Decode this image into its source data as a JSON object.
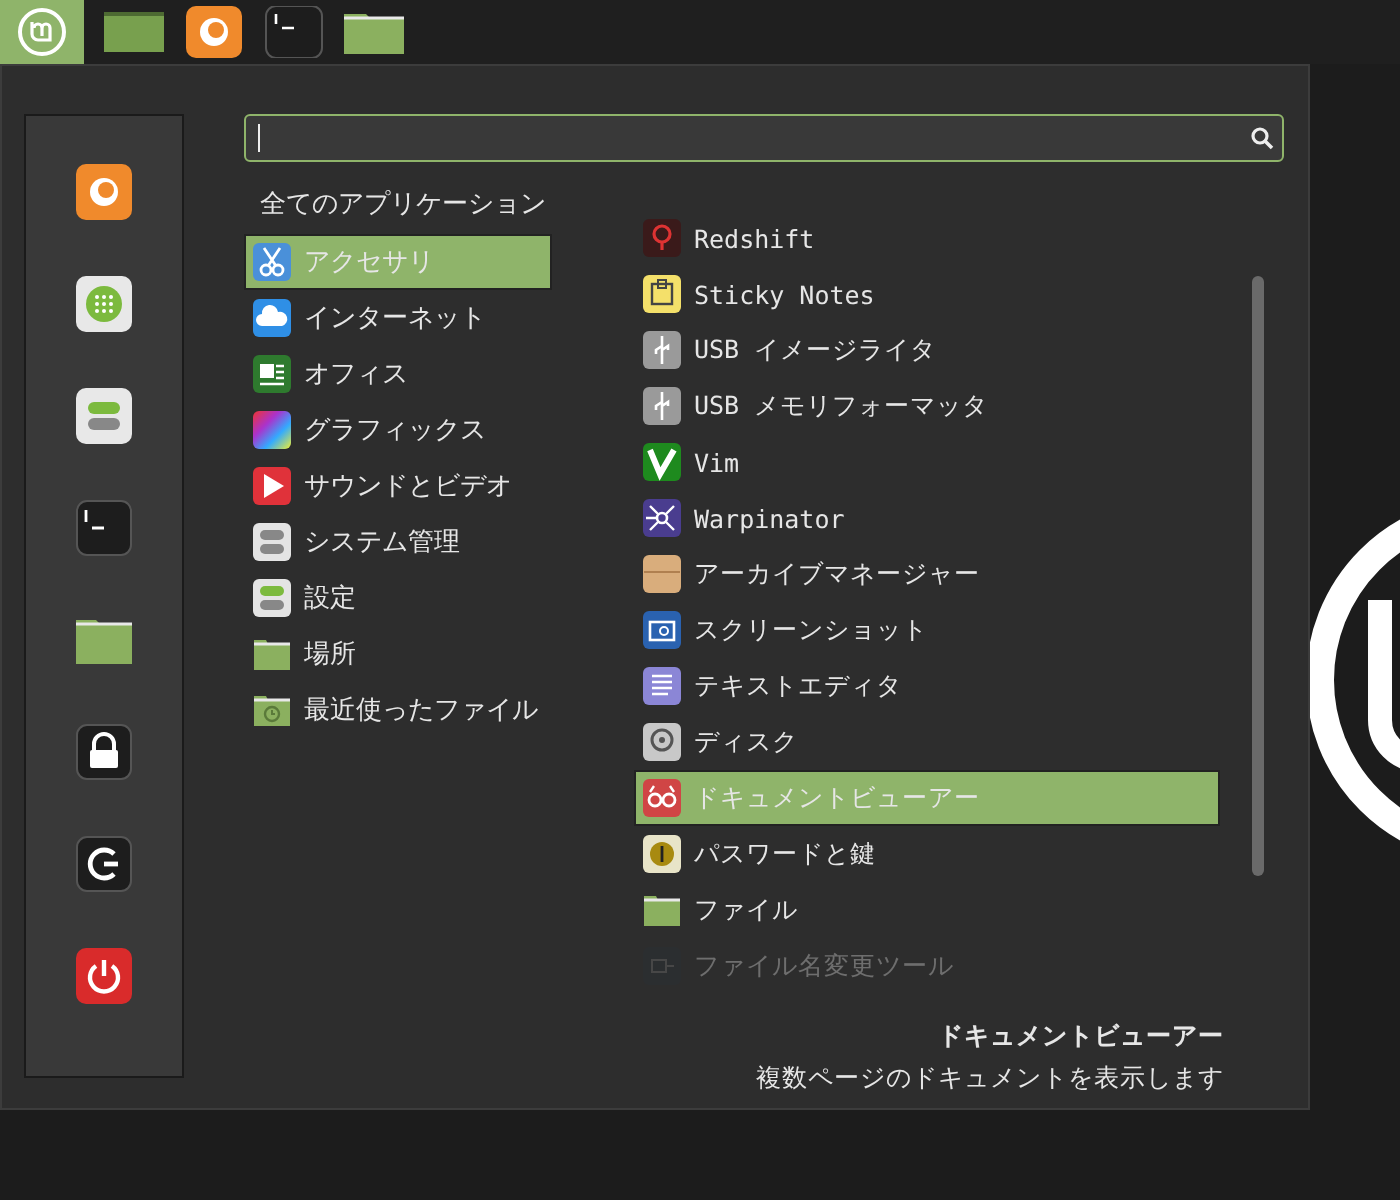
{
  "categories": {
    "header": "全てのアプリケーション",
    "items": [
      {
        "label": "アクセサリ",
        "selected": true
      },
      {
        "label": "インターネット",
        "selected": false
      },
      {
        "label": "オフィス",
        "selected": false
      },
      {
        "label": "グラフィックス",
        "selected": false
      },
      {
        "label": "サウンドとビデオ",
        "selected": false
      },
      {
        "label": "システム管理",
        "selected": false
      },
      {
        "label": "設定",
        "selected": false
      },
      {
        "label": "場所",
        "selected": false
      },
      {
        "label": "最近使ったファイル",
        "selected": false
      }
    ]
  },
  "apps": [
    {
      "name": "Redshift",
      "selected": false,
      "faded": false
    },
    {
      "name": "Sticky Notes",
      "selected": false,
      "faded": false
    },
    {
      "name": "USB イメージライタ",
      "selected": false,
      "faded": false
    },
    {
      "name": "USB メモリフォーマッタ",
      "selected": false,
      "faded": false
    },
    {
      "name": "Vim",
      "selected": false,
      "faded": false
    },
    {
      "name": "Warpinator",
      "selected": false,
      "faded": false
    },
    {
      "name": "アーカイブマネージャー",
      "selected": false,
      "faded": false
    },
    {
      "name": "スクリーンショット",
      "selected": false,
      "faded": false
    },
    {
      "name": "テキストエディタ",
      "selected": false,
      "faded": false
    },
    {
      "name": "ディスク",
      "selected": false,
      "faded": false
    },
    {
      "name": "ドキュメントビューアー",
      "selected": true,
      "faded": false
    },
    {
      "name": "パスワードと鍵",
      "selected": false,
      "faded": false
    },
    {
      "name": "ファイル",
      "selected": false,
      "faded": false
    },
    {
      "name": "ファイル名変更ツール",
      "selected": false,
      "faded": true
    }
  ],
  "description": {
    "title": "ドキュメントビューアー",
    "text": "複数ページのドキュメントを表示します"
  }
}
